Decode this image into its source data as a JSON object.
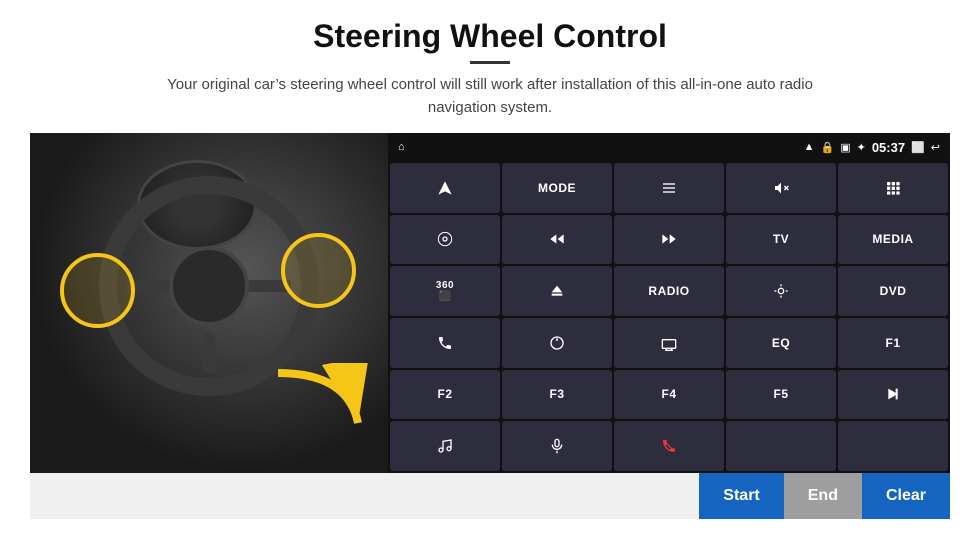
{
  "title": "Steering Wheel Control",
  "subtitle": "Your original car’s steering wheel control will still work after installation of this all-in-one auto radio navigation system.",
  "status_bar": {
    "time": "05:37",
    "icons": [
      "wifi",
      "lock",
      "sim",
      "bt",
      "screen-mirror",
      "back"
    ]
  },
  "buttons": [
    {
      "id": "b1",
      "label": "",
      "icon": "navigate"
    },
    {
      "id": "b2",
      "label": "MODE",
      "icon": ""
    },
    {
      "id": "b3",
      "label": "",
      "icon": "list"
    },
    {
      "id": "b4",
      "label": "",
      "icon": "mute"
    },
    {
      "id": "b5",
      "label": "",
      "icon": "apps"
    },
    {
      "id": "b6",
      "label": "",
      "icon": "settings-circle"
    },
    {
      "id": "b7",
      "label": "",
      "icon": "rewind"
    },
    {
      "id": "b8",
      "label": "",
      "icon": "fast-forward"
    },
    {
      "id": "b9",
      "label": "TV",
      "icon": ""
    },
    {
      "id": "b10",
      "label": "MEDIA",
      "icon": ""
    },
    {
      "id": "b11",
      "label": "",
      "icon": "360-cam"
    },
    {
      "id": "b12",
      "label": "",
      "icon": "eject"
    },
    {
      "id": "b13",
      "label": "RADIO",
      "icon": ""
    },
    {
      "id": "b14",
      "label": "",
      "icon": "brightness"
    },
    {
      "id": "b15",
      "label": "DVD",
      "icon": ""
    },
    {
      "id": "b16",
      "label": "",
      "icon": "phone"
    },
    {
      "id": "b17",
      "label": "",
      "icon": "navigation-circle"
    },
    {
      "id": "b18",
      "label": "",
      "icon": "rectangle"
    },
    {
      "id": "b19",
      "label": "EQ",
      "icon": ""
    },
    {
      "id": "b20",
      "label": "F1",
      "icon": ""
    },
    {
      "id": "b21",
      "label": "F2",
      "icon": ""
    },
    {
      "id": "b22",
      "label": "F3",
      "icon": ""
    },
    {
      "id": "b23",
      "label": "F4",
      "icon": ""
    },
    {
      "id": "b24",
      "label": "F5",
      "icon": ""
    },
    {
      "id": "b25",
      "label": "",
      "icon": "play-pause"
    },
    {
      "id": "b26",
      "label": "",
      "icon": "music"
    },
    {
      "id": "b27",
      "label": "",
      "icon": "microphone"
    },
    {
      "id": "b28",
      "label": "",
      "icon": "phone-end"
    },
    {
      "id": "b29",
      "label": "",
      "icon": ""
    },
    {
      "id": "b30",
      "label": "",
      "icon": ""
    }
  ],
  "bottom_bar": {
    "start_label": "Start",
    "end_label": "End",
    "clear_label": "Clear"
  }
}
